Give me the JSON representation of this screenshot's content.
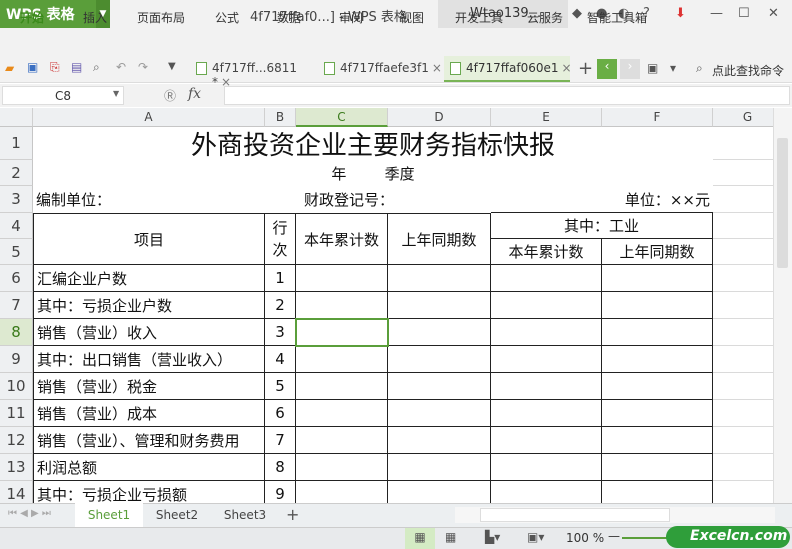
{
  "app": {
    "name": "WPS 表格",
    "title": "4f717ffaf0...] - WPS 表格",
    "user": "Wtao139...",
    "search": "点此查找命令"
  },
  "menu": [
    "开始",
    "插入",
    "页面布局",
    "公式",
    "数据",
    "审阅",
    "视图",
    "开发工具",
    "云服务",
    "智能工具箱"
  ],
  "doc_tabs": [
    {
      "label": "4f717ff...6811 *",
      "active": false
    },
    {
      "label": "4f717ffaefe3f1",
      "active": false
    },
    {
      "label": "4f717ffaf060e1",
      "active": true
    }
  ],
  "formula": {
    "name_box": "C8",
    "fx": "fx",
    "value": ""
  },
  "columns": [
    "A",
    "B",
    "C",
    "D",
    "E",
    "F",
    "G"
  ],
  "selected_col": "C",
  "selected_row": 8,
  "row_numbers": [
    1,
    2,
    3,
    4,
    5,
    6,
    7,
    8,
    9,
    10,
    11,
    12,
    13,
    14
  ],
  "sheet": {
    "title": "外商投资企业主要财务指标快报",
    "period": "年        季度",
    "unit_label": "编制单位：",
    "reg_label": "财政登记号：",
    "currency": "单位：××元",
    "h_item": "项目",
    "h_line": "行次",
    "h_cur": "本年累计数",
    "h_prev": "上年同期数",
    "h_industry": "其中：工业",
    "h_ind_cur": "本年累计数",
    "h_ind_prev": "上年同期数",
    "items": [
      {
        "name": "汇编企业户数",
        "line": "1"
      },
      {
        "name": "其中：亏损企业户数",
        "line": "2"
      },
      {
        "name": "销售（营业）收入",
        "line": "3"
      },
      {
        "name": "其中：出口销售（营业收入）",
        "line": "4"
      },
      {
        "name": "销售（营业）税金",
        "line": "5"
      },
      {
        "name": "销售（营业）成本",
        "line": "6"
      },
      {
        "name": "销售（营业）、管理和财务费用",
        "line": "7"
      },
      {
        "name": "利润总额",
        "line": "8"
      },
      {
        "name": "其中：亏损企业亏损额",
        "line": "9"
      }
    ]
  },
  "sheet_tabs": [
    "Sheet1",
    "Sheet2",
    "Sheet3"
  ],
  "active_sheet": "Sheet1",
  "status": {
    "zoom": "100 %",
    "watermark": "Excelcn.com"
  },
  "colors": {
    "accent": "#5a9e3a"
  }
}
